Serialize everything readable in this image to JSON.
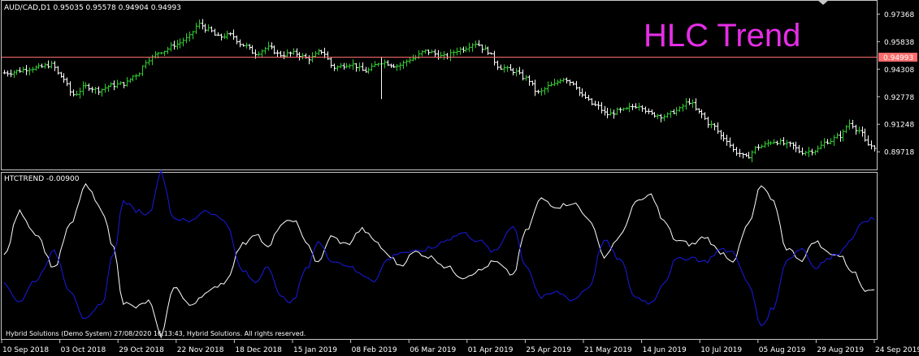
{
  "colors": {
    "background": "#000000",
    "frame": "#c8c8c8",
    "bar_up": "#2ecc2e",
    "bar_down": "#ffffff",
    "price_line": "#ff6b6b",
    "price_badge": "#ff6b6b",
    "line_white": "#ffffff",
    "line_blue": "#1a1ae6",
    "overlay_title": "#e62ee6"
  },
  "header": {
    "price_info": "AUD/CAD,D1  0.95035  0.95578  0.94904  0.94993",
    "indicator_info": "HTCTREND  -0.00900",
    "overlay_title": "HLC Trend",
    "copyright": "Hybrid Solutions (Demo System) 27/08/2020 16:13:43, Hybrid Solutions. All rights reserved."
  },
  "chart_data": [
    {
      "type": "ohlc",
      "symbol": "AUD/CAD",
      "timeframe": "D1",
      "last": {
        "open": 0.95035,
        "high": 0.95578,
        "low": 0.94904,
        "close": 0.94993
      },
      "current_price_label": "0.94993",
      "y_ticks": [
        "0.97368",
        "0.95838",
        "0.94308",
        "0.92778",
        "0.91248",
        "0.89718"
      ],
      "y_tick_values": [
        0.97368,
        0.95838,
        0.94308,
        0.92778,
        0.91248,
        0.89718
      ],
      "ylim": [
        0.8878,
        0.9806
      ],
      "x_ticks": [
        "10 Sep 2018",
        "03 Oct 2018",
        "29 Oct 2018",
        "22 Nov 2018",
        "18 Dec 2018",
        "15 Jan 2019",
        "08 Feb 2019",
        "06 Mar 2019",
        "01 Apr 2019",
        "25 Apr 2019",
        "21 May 2019",
        "14 Jun 2019",
        "10 Jul 2019",
        "05 Aug 2019",
        "29 Aug 2019",
        "24 Sep 2019"
      ],
      "close_keypoints": [
        [
          0,
          0.941
        ],
        [
          10,
          0.9438
        ],
        [
          15,
          0.9455
        ],
        [
          18,
          0.939
        ],
        [
          22,
          0.929
        ],
        [
          26,
          0.9335
        ],
        [
          30,
          0.9315
        ],
        [
          34,
          0.934
        ],
        [
          38,
          0.935
        ],
        [
          42,
          0.94
        ],
        [
          46,
          0.9488
        ],
        [
          50,
          0.953
        ],
        [
          55,
          0.957
        ],
        [
          58,
          0.96
        ],
        [
          62,
          0.968
        ],
        [
          65,
          0.965
        ],
        [
          68,
          0.961
        ],
        [
          72,
          0.962
        ],
        [
          76,
          0.9565
        ],
        [
          80,
          0.952
        ],
        [
          84,
          0.955
        ],
        [
          88,
          0.951
        ],
        [
          92,
          0.952
        ],
        [
          97,
          0.949
        ],
        [
          101,
          0.953
        ],
        [
          105,
          0.944
        ],
        [
          110,
          0.946
        ],
        [
          115,
          0.942
        ],
        [
          120,
          0.947
        ],
        [
          125,
          0.945
        ],
        [
          130,
          0.949
        ],
        [
          134,
          0.953
        ],
        [
          140,
          0.95
        ],
        [
          145,
          0.954
        ],
        [
          150,
          0.9575
        ],
        [
          153,
          0.954
        ],
        [
          158,
          0.944
        ],
        [
          162,
          0.942
        ],
        [
          166,
          0.938
        ],
        [
          170,
          0.93
        ],
        [
          174,
          0.934
        ],
        [
          178,
          0.938
        ],
        [
          181,
          0.9355
        ],
        [
          184,
          0.928
        ],
        [
          188,
          0.923
        ],
        [
          192,
          0.918
        ],
        [
          196,
          0.92
        ],
        [
          202,
          0.923
        ],
        [
          206,
          0.918
        ],
        [
          210,
          0.917
        ],
        [
          214,
          0.92
        ],
        [
          218,
          0.925
        ],
        [
          221,
          0.919
        ],
        [
          225,
          0.912
        ],
        [
          229,
          0.905
        ],
        [
          233,
          0.897
        ],
        [
          236,
          0.894
        ],
        [
          240,
          0.9
        ],
        [
          245,
          0.903
        ],
        [
          250,
          0.901
        ],
        [
          254,
          0.897
        ],
        [
          258,
          0.898
        ],
        [
          262,
          0.903
        ],
        [
          266,
          0.906
        ],
        [
          269,
          0.913
        ],
        [
          272,
          0.909
        ],
        [
          275,
          0.901
        ],
        [
          277,
          0.9
        ]
      ]
    },
    {
      "type": "line",
      "name": "HTCTREND",
      "value_label": "-0.00900",
      "series": [
        {
          "color": "#ffffff",
          "keypoints": [
            [
              0,
              0.0
            ],
            [
              5,
              0.58
            ],
            [
              10,
              0.3
            ],
            [
              16,
              -0.15
            ],
            [
              21,
              0.4
            ],
            [
              26,
              0.92
            ],
            [
              31,
              0.62
            ],
            [
              35,
              0.1
            ],
            [
              38,
              -0.62
            ],
            [
              42,
              -0.68
            ],
            [
              46,
              -0.6
            ],
            [
              50,
              -1.05
            ],
            [
              54,
              -0.4
            ],
            [
              59,
              -0.65
            ],
            [
              64,
              -0.5
            ],
            [
              70,
              -0.35
            ],
            [
              76,
              0.15
            ],
            [
              80,
              0.3
            ],
            [
              84,
              0.1
            ],
            [
              88,
              0.4
            ],
            [
              92,
              0.48
            ],
            [
              96,
              0.2
            ],
            [
              100,
              -0.1
            ],
            [
              104,
              0.25
            ],
            [
              109,
              0.15
            ],
            [
              114,
              0.35
            ],
            [
              118,
              0.2
            ],
            [
              122,
              0.02
            ],
            [
              126,
              -0.12
            ],
            [
              131,
              0.05
            ],
            [
              136,
              -0.02
            ],
            [
              141,
              -0.15
            ],
            [
              146,
              -0.28
            ],
            [
              151,
              -0.2
            ],
            [
              156,
              -0.08
            ],
            [
              162,
              -0.25
            ],
            [
              166,
              0.32
            ],
            [
              171,
              0.75
            ],
            [
              176,
              0.65
            ],
            [
              181,
              0.7
            ],
            [
              186,
              0.5
            ],
            [
              191,
              0.0
            ],
            [
              196,
              0.25
            ],
            [
              201,
              0.7
            ],
            [
              206,
              0.8
            ],
            [
              210,
              0.45
            ],
            [
              214,
              0.2
            ],
            [
              219,
              0.15
            ],
            [
              223,
              0.25
            ],
            [
              228,
              0.05
            ],
            [
              232,
              -0.06
            ],
            [
              237,
              0.42
            ],
            [
              241,
              0.92
            ],
            [
              245,
              0.7
            ],
            [
              249,
              0.1
            ],
            [
              254,
              -0.05
            ],
            [
              258,
              0.2
            ],
            [
              262,
              0.05
            ],
            [
              266,
              0.0
            ],
            [
              270,
              -0.2
            ],
            [
              274,
              -0.44
            ],
            [
              277,
              -0.42
            ]
          ]
        },
        {
          "color": "#1a1ae6",
          "keypoints": [
            [
              0,
              -0.38
            ],
            [
              5,
              -0.6
            ],
            [
              10,
              -0.32
            ],
            [
              16,
              0.05
            ],
            [
              21,
              -0.45
            ],
            [
              26,
              -0.85
            ],
            [
              31,
              -0.65
            ],
            [
              35,
              0.05
            ],
            [
              38,
              0.72
            ],
            [
              42,
              0.6
            ],
            [
              46,
              0.55
            ],
            [
              50,
              1.1
            ],
            [
              54,
              0.5
            ],
            [
              59,
              0.45
            ],
            [
              64,
              0.6
            ],
            [
              70,
              0.48
            ],
            [
              76,
              -0.2
            ],
            [
              80,
              -0.35
            ],
            [
              84,
              -0.12
            ],
            [
              88,
              -0.55
            ],
            [
              92,
              -0.6
            ],
            [
              96,
              -0.18
            ],
            [
              100,
              0.18
            ],
            [
              104,
              -0.05
            ],
            [
              109,
              -0.12
            ],
            [
              114,
              -0.25
            ],
            [
              118,
              -0.32
            ],
            [
              122,
              -0.05
            ],
            [
              126,
              0.05
            ],
            [
              131,
              0.05
            ],
            [
              136,
              0.1
            ],
            [
              141,
              0.22
            ],
            [
              146,
              0.3
            ],
            [
              151,
              0.2
            ],
            [
              156,
              0.05
            ],
            [
              162,
              0.4
            ],
            [
              166,
              -0.12
            ],
            [
              171,
              -0.55
            ],
            [
              176,
              -0.48
            ],
            [
              181,
              -0.58
            ],
            [
              186,
              -0.42
            ],
            [
              191,
              0.2
            ],
            [
              196,
              -0.05
            ],
            [
              201,
              -0.55
            ],
            [
              206,
              -0.62
            ],
            [
              210,
              -0.35
            ],
            [
              214,
              -0.05
            ],
            [
              219,
              -0.02
            ],
            [
              223,
              -0.08
            ],
            [
              228,
              0.08
            ],
            [
              232,
              0.05
            ],
            [
              237,
              -0.38
            ],
            [
              241,
              -0.92
            ],
            [
              245,
              -0.68
            ],
            [
              249,
              -0.05
            ],
            [
              254,
              0.1
            ],
            [
              258,
              -0.15
            ],
            [
              262,
              -0.05
            ],
            [
              266,
              0.05
            ],
            [
              270,
              0.25
            ],
            [
              274,
              0.48
            ],
            [
              277,
              0.48
            ]
          ]
        }
      ]
    }
  ]
}
